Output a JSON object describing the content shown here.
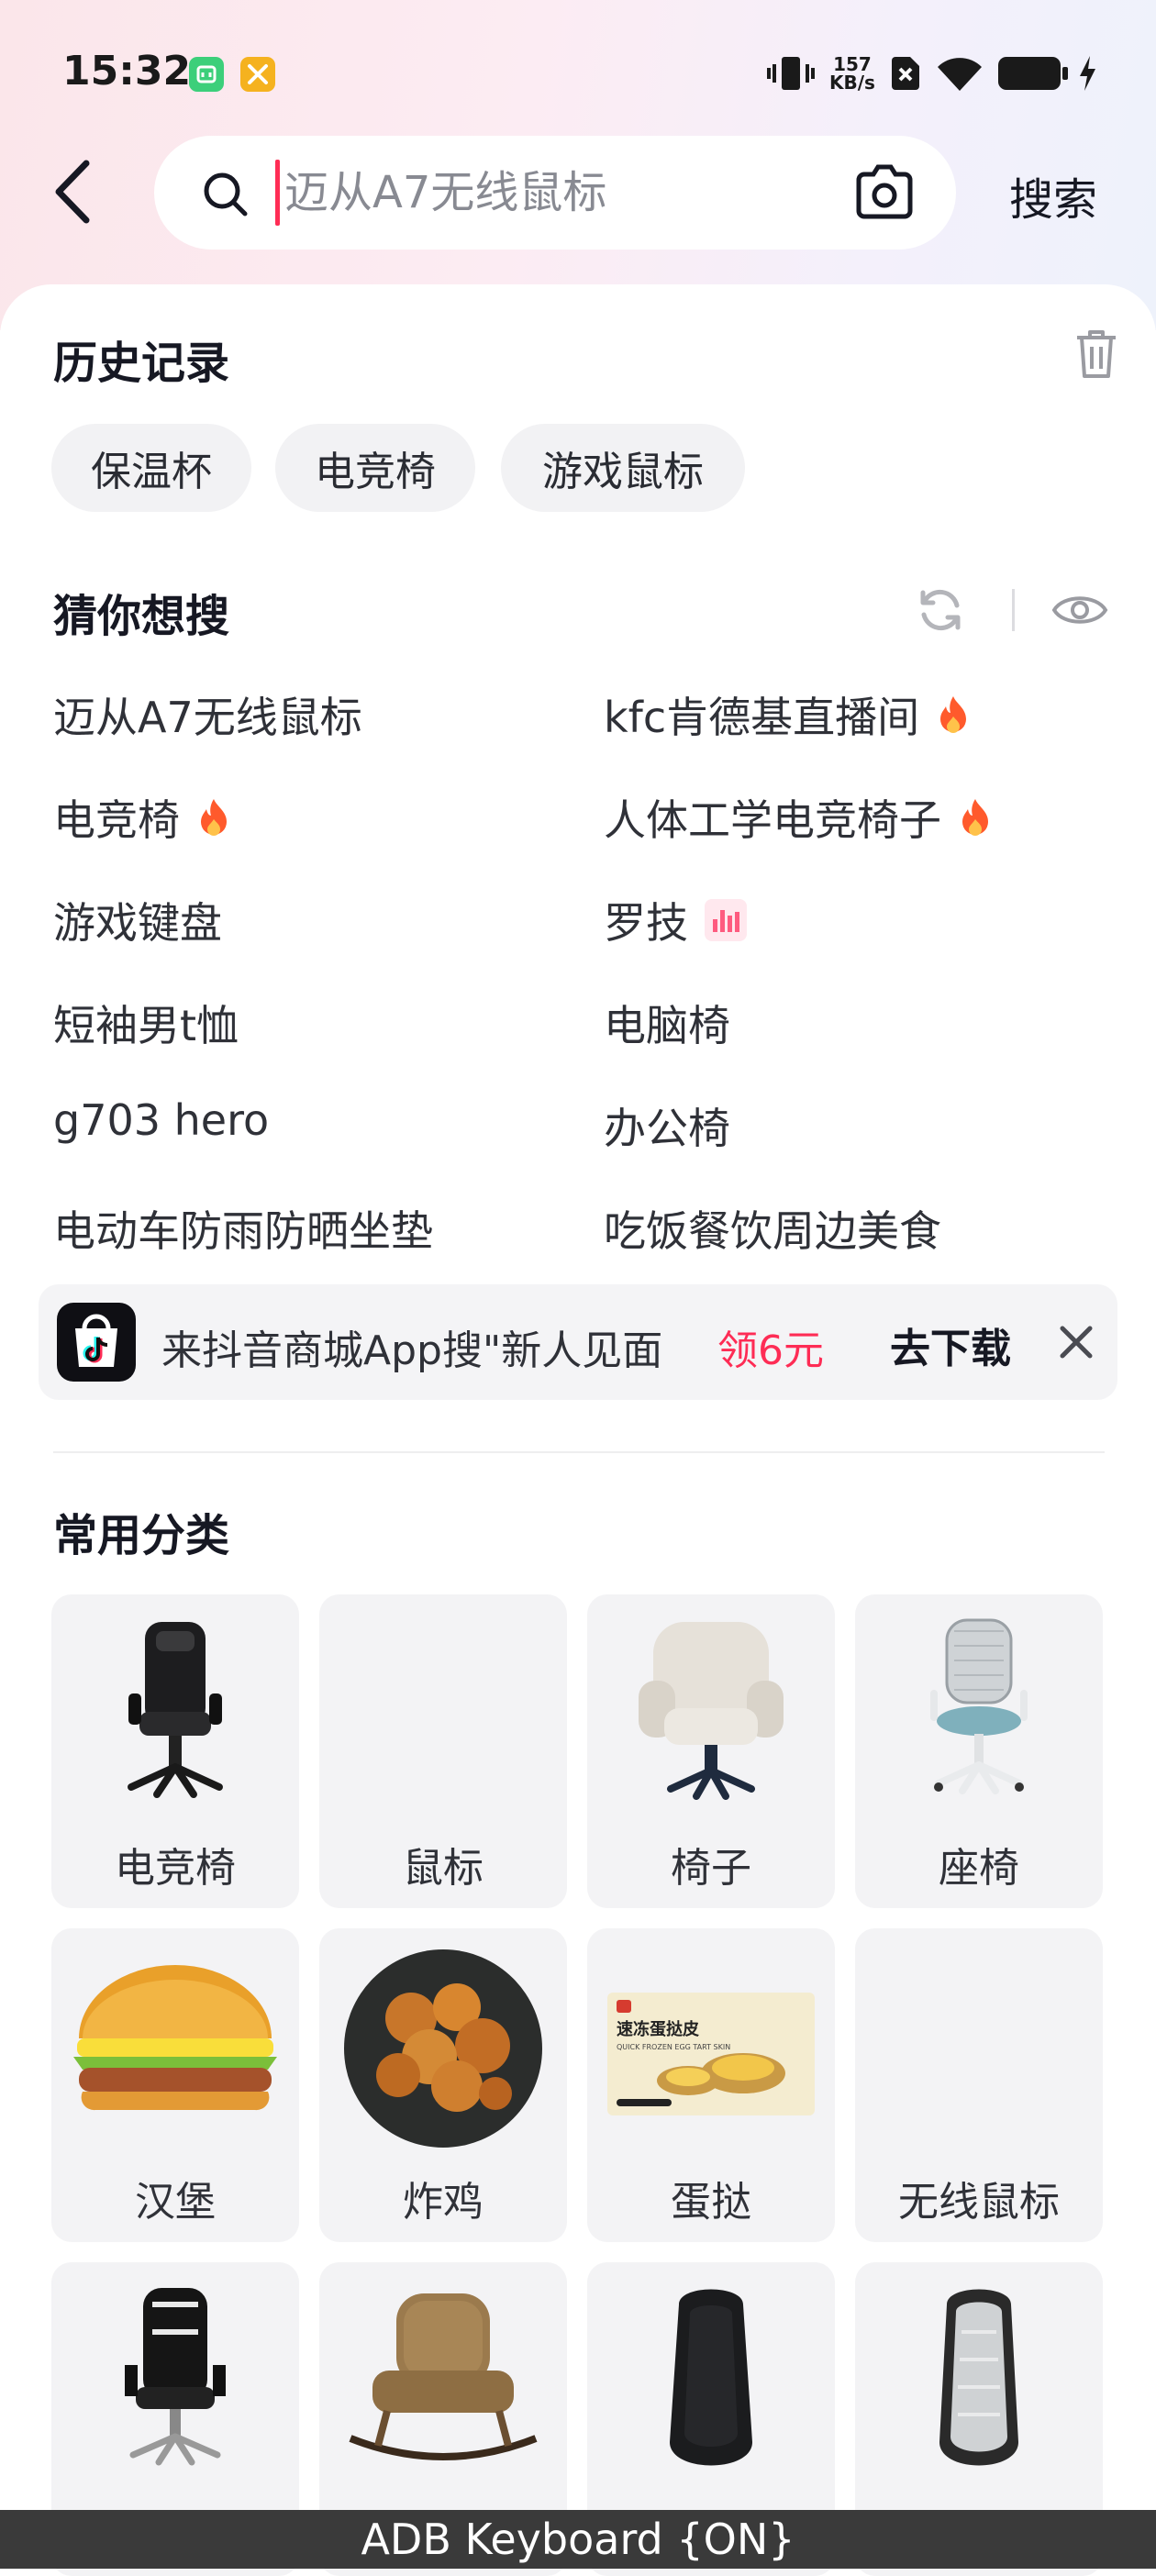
{
  "status_bar": {
    "time": "15:32",
    "net_speed_value": "157",
    "net_speed_unit": "KB/s"
  },
  "search": {
    "placeholder": "迈从A7无线鼠标",
    "value": "",
    "button_label": "搜索"
  },
  "history": {
    "title": "历史记录",
    "items": [
      "保温杯",
      "电竞椅",
      "游戏鼠标"
    ]
  },
  "guess": {
    "title": "猜你想搜",
    "left": [
      {
        "label": "迈从A7无线鼠标",
        "badge": ""
      },
      {
        "label": "电竞椅",
        "badge": "fire-icon"
      },
      {
        "label": "游戏键盘",
        "badge": ""
      },
      {
        "label": "短袖男t恤",
        "badge": ""
      },
      {
        "label": "g703 hero",
        "badge": ""
      },
      {
        "label": "电动车防雨防晒坐垫",
        "badge": ""
      }
    ],
    "right": [
      {
        "label": "kfc肯德基直播间",
        "badge": "fire-icon"
      },
      {
        "label": "人体工学电竞椅子",
        "badge": "fire-icon"
      },
      {
        "label": "罗技",
        "badge": "trending-chart-icon"
      },
      {
        "label": "电脑椅",
        "badge": ""
      },
      {
        "label": "办公椅",
        "badge": ""
      },
      {
        "label": "吃饭餐饮周边美食",
        "badge": ""
      }
    ]
  },
  "banner": {
    "text": "来抖音商城App搜\"新人见面",
    "highlight": "领6元",
    "action": "去下载"
  },
  "categories": {
    "title": "常用分类",
    "items": [
      {
        "label": "电竞椅"
      },
      {
        "label": "鼠标"
      },
      {
        "label": "椅子"
      },
      {
        "label": "座椅"
      },
      {
        "label": "汉堡"
      },
      {
        "label": "炸鸡"
      },
      {
        "label": "蛋挞"
      },
      {
        "label": "无线鼠标"
      },
      {
        "label": ""
      },
      {
        "label": ""
      },
      {
        "label": ""
      },
      {
        "label": ""
      }
    ],
    "egg_tart_pack": {
      "title": "速冻蛋挞皮",
      "subtitle": "QUICK FROZEN EGG TART SKIN"
    }
  },
  "keyboard_indicator": "ADB Keyboard {ON}",
  "colors": {
    "accent": "#fe2c55",
    "chip_bg": "#f2f2f4",
    "card_bg": "#f3f3f5"
  }
}
